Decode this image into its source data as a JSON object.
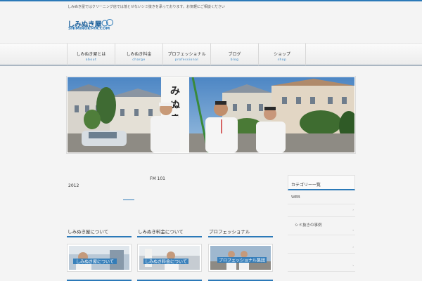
{
  "site": {
    "tagline": "しみぬき屋ではクリーニング店では落とせないシミ抜きを承っております。お気軽にご相談ください",
    "logo_text": "しみぬき屋",
    "logo_sub": "SHIMINUKI-YA.COM",
    "accent_color": "#2b79b8"
  },
  "nav": {
    "items": [
      {
        "label": "しみぬき屋とは",
        "sub": "about"
      },
      {
        "label": "しみぬき料金",
        "sub": "charge"
      },
      {
        "label": "プロフェッショナル",
        "sub": "professional"
      },
      {
        "label": "ブログ",
        "sub": "blog"
      },
      {
        "label": "ショップ",
        "sub": "shop"
      }
    ]
  },
  "hero": {
    "banner_text": "しみぬき屋"
  },
  "main": {
    "radio_text": "FM 101",
    "year_text": "2012"
  },
  "sidebar": {
    "heading": "カテゴリー一覧",
    "web_label": "WEB",
    "item_label": "シミ抜きの事例"
  },
  "cards": [
    {
      "title": "しみぬき屋について",
      "banner": "しみぬき屋について"
    },
    {
      "title": "しみぬき料金について",
      "banner": "しみぬき料金について"
    },
    {
      "title": "プロフェッショナル",
      "banner": "プロフェッショナル集団"
    }
  ]
}
